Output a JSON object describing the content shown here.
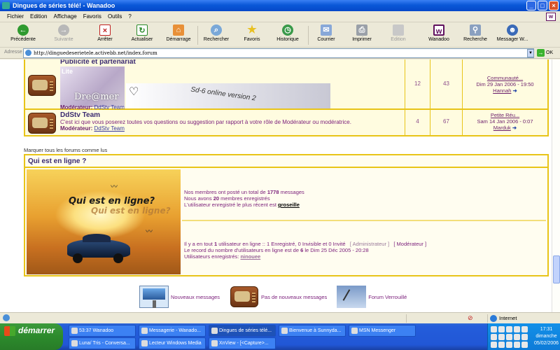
{
  "window": {
    "title": "Dingues de séries télé! - Wanadoo"
  },
  "menu": [
    "Fichier",
    "Edition",
    "Affichage",
    "Favoris",
    "Outils",
    "?"
  ],
  "toolbar": {
    "back": "Précédente",
    "forward": "Suivante",
    "stop": "Arrêter",
    "refresh": "Actualiser",
    "home": "Démarrage",
    "search": "Rechercher",
    "favorites": "Favoris",
    "history": "Historique",
    "mail": "Courrier",
    "print": "Imprimer",
    "edit": "Edition",
    "wanadoo": "Wanadoo",
    "wsearch": "Recherche",
    "messenger": "Messager W..."
  },
  "address": {
    "label": "Adresse",
    "url": "http://dinguedeserietele.activebb.net/index.forum",
    "go": "OK"
  },
  "forums": [
    {
      "title": "Publicité et partenariat",
      "banner_left": "Dre@mer",
      "banner_left_top": "Lite",
      "banner_right": "Sd-6 online version 2",
      "moderator_label": "Modérateur:",
      "moderator": "DdStv Team",
      "topics": "12",
      "posts": "43",
      "last_topic": "Communauté...",
      "last_date": "Dim 29 Jan 2006 - 19:50",
      "last_user": "Hannah"
    },
    {
      "title": "DdStv Team",
      "description": "C'est ici que vous poserez toutes vos questions ou suggestion par rapport à votre rôle de Modérateur ou modératrice.",
      "moderator_label": "Modérateur:",
      "moderator": "DdStv Team",
      "topics": "4",
      "posts": "67",
      "last_topic": "Petite Réu...",
      "last_date": "Sam 14 Jan 2006 - 0:07",
      "last_user": "Marduk"
    }
  ],
  "mark_all": "Marquer tous les forums comme lus",
  "online": {
    "header": "Qui est en ligne ?",
    "image_text1": "Qui est en ligne?",
    "image_text2": "Qui est en ligne?",
    "stats_line1_pre": "Nos membres ont posté un total de",
    "stats_total": "1778",
    "stats_line1_post": "messages",
    "stats_line2_pre": "Nous avons",
    "stats_members": "20",
    "stats_line2_post": "membres enregistrés",
    "stats_line3_pre": "L'utilisateur enregistré le plus récent est",
    "stats_newest": "groseille",
    "users_line1_pre": "Il y a en tout",
    "users_count": "1",
    "users_line1_post": "utilisateur en ligne :: 1 Enregistré, 0 Invisible et 0 Invité",
    "admin_tag": "[ Administrateur ]",
    "mod_tag": "[ Modérateur ]",
    "record_pre": "Le record du nombre d'utilisateurs en ligne est de",
    "record_count": "6",
    "record_post": "le Dim 25 Déc 2005 - 20:28",
    "registered_label": "Utilisateurs enregistrés:",
    "registered_user": "ninouee"
  },
  "legend": {
    "new_posts": "Nouveaux messages",
    "no_new_posts": "Pas de nouveaux messages",
    "locked": "Forum Verrouillé"
  },
  "status": {
    "zone": "Internet"
  },
  "taskbar": {
    "start": "démarrer",
    "tasks_row1": [
      "53:37 Wanadoo",
      "Messagerie - Wanado...",
      "Dingues de séries télé...",
      "Bienvenue à Sunnyda...",
      "MSN Messenger"
    ],
    "tasks_row2": [
      "Luna/ Tris - Conversa...",
      "Lecteur Windows Media",
      "XnView - [<Capture>..."
    ],
    "time": "17:31",
    "day": "dimanche",
    "date": "05/02/2006"
  }
}
